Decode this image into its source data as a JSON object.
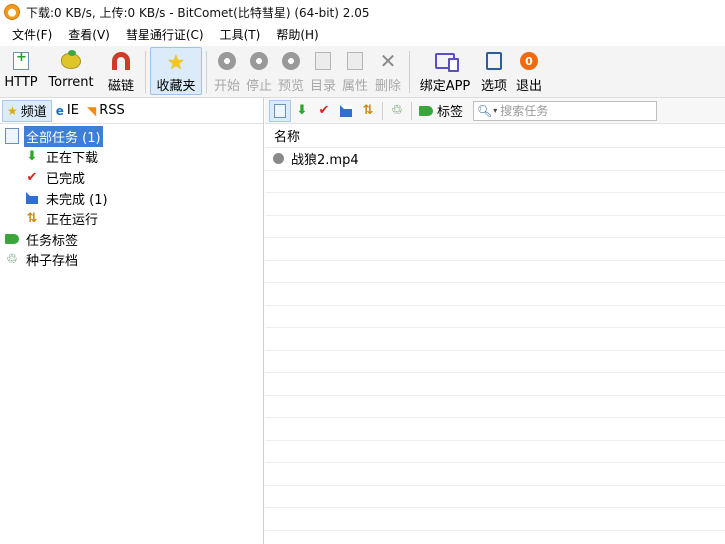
{
  "window": {
    "title": "下载:0 KB/s, 上传:0 KB/s - BitComet(比特彗星) (64-bit) 2.05"
  },
  "menu": [
    "文件(F)",
    "查看(V)",
    "彗星通行证(C)",
    "工具(T)",
    "帮助(H)"
  ],
  "toolbar": {
    "http": "HTTP",
    "torrent": "Torrent",
    "magnet": "磁链",
    "favorites": "收藏夹",
    "start": "开始",
    "stop": "停止",
    "preview": "预览",
    "directory": "目录",
    "properties": "属性",
    "delete": "删除",
    "bind_app": "绑定APP",
    "options": "选项",
    "exit": "退出",
    "exit_glyph": "0"
  },
  "left_tabs": {
    "channel": "频道",
    "ie": "IE",
    "rss": "RSS"
  },
  "tree": {
    "all_tasks": "全部任务 (1)",
    "downloading": "正在下载",
    "completed": "已完成",
    "incomplete": "未完成 (1)",
    "running": "正在运行",
    "task_tags": "任务标签",
    "torrent_archive": "种子存档"
  },
  "right_toolbar": {
    "tag_label": "标签",
    "search_placeholder": "搜索任务"
  },
  "task_list": {
    "column_name": "名称",
    "rows": [
      {
        "name": "战狼2.mp4"
      }
    ]
  }
}
